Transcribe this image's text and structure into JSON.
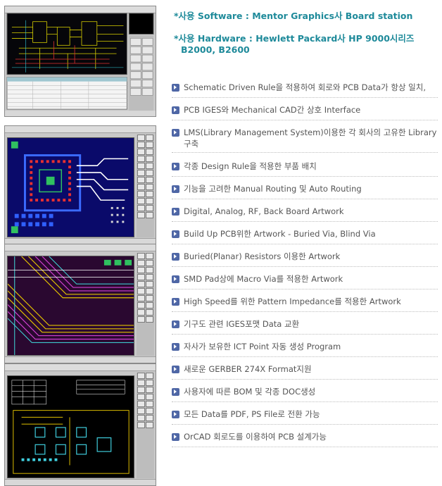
{
  "header": {
    "software": "*사용 Software : Mentor Graphics사 Board station",
    "hardware_line1": "*사용 Hardware : Hewlett Packard사 HP 9000시리즈",
    "hardware_line2": "B2000, B2600"
  },
  "features": [
    "Schematic Driven Rule을 적용하여 회로와 PCB Data가 항상 일치,",
    "PCB IGES와 Mechanical CAD간 상호 Interface",
    "LMS(Library Management System)이용한 각 회사의 고유한 Library 구축",
    "각종 Design Rule을 적용한 부품 배치",
    "기능을 고려한 Manual Routing 및 Auto Routing",
    "Digital, Analog, RF, Back Board Artwork",
    "Build Up PCB위한 Artwork - Buried Via, Blind Via",
    "Buried(Planar) Resistors 이용한 Artwork",
    "SMD Pad상에 Macro Via를 적용한 Artwork",
    "High Speed를 위한 Pattern Impedance를 적용한 Artwork",
    "기구도 관련 IGES포맷 Data 교환",
    "자사가 보유한 ICT Point 자동 생성 Program",
    "새로운 GERBER 274X Format지원",
    "사용자에 따른 BOM 및 각종 DOC생성",
    "모든 Data를 PDF, PS File로 전환 가능",
    "OrCAD 회로도를 이용하여 PCB 설계가능"
  ],
  "colors": {
    "heading": "#1e8a9a",
    "bullet": "#4f67a6",
    "text": "#555555"
  }
}
